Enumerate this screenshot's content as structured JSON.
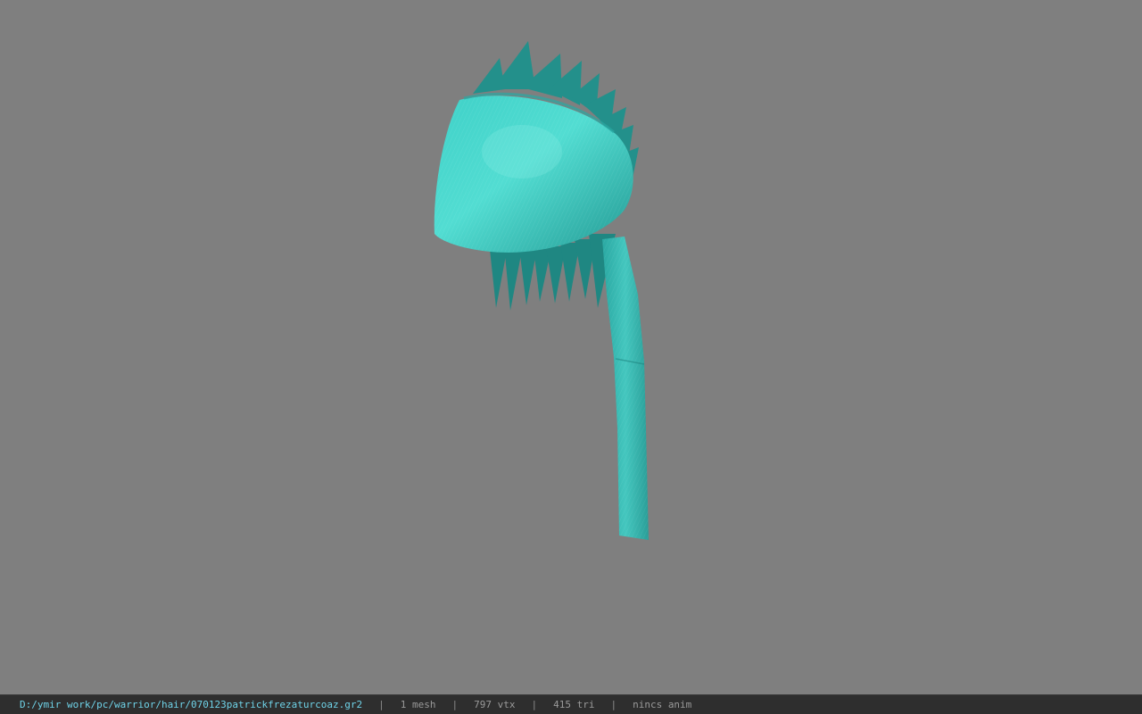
{
  "viewport": {
    "background_color": "#7f7f7f",
    "model": {
      "name": "hair-bandana-mesh",
      "primary_color": "#3fc9c3",
      "shadow_color": "#1f8a86",
      "highlight_color": "#7fe8e0"
    }
  },
  "status_bar": {
    "file_path": "D:/ymir work/pc/warrior/hair/070123patrickfrezaturcoaz.gr2",
    "mesh_count": "1 mesh",
    "vertex_count": "797 vtx",
    "triangle_count": "415 tri",
    "anim_status": "nincs anim",
    "separator": "|"
  }
}
